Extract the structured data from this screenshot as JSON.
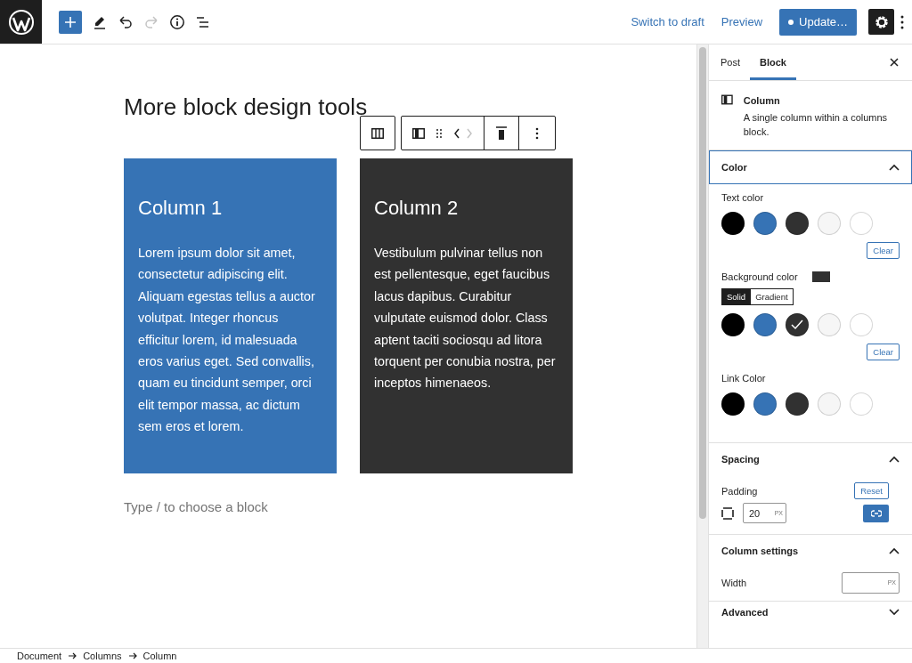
{
  "topbar": {
    "tools": [
      {
        "kind": "inserter",
        "disabled": false
      },
      {
        "kind": "edit",
        "disabled": false
      },
      {
        "kind": "undo",
        "disabled": false
      },
      {
        "kind": "redo",
        "disabled": true
      },
      {
        "kind": "details",
        "disabled": false
      },
      {
        "kind": "outline",
        "disabled": false
      }
    ],
    "links": [
      "Switch to draft",
      "Preview"
    ],
    "update_button": "Update…",
    "settings_active": true
  },
  "editor": {
    "title": "More block design tools",
    "block_toolbar": {
      "movers": [
        {
          "kind": "left",
          "disabled": false
        },
        {
          "kind": "right",
          "disabled": true
        }
      ]
    },
    "columns": [
      {
        "heading": "Column 1",
        "text": "Lorem ipsum dolor sit amet, consectetur adipiscing elit. Aliquam egestas tellus a auctor volutpat. Integer rhoncus efficitur lorem, id malesuada eros varius eget. Sed convallis, quam eu tincidunt semper, orci elit tempor massa, ac dictum sem eros et lorem.",
        "color": "#3673b5"
      },
      {
        "heading": "Column 2",
        "text": "Vestibulum pulvinar tellus non est pellentesque, eget faucibus lacus dapibus. Curabitur vulputate euismod dolor. Class aptent taciti sociosqu ad litora torquent per conubia nostra, per inceptos himenaeos.",
        "color": "#313131"
      }
    ],
    "placeholder": "Type / to choose a block"
  },
  "sidebar": {
    "tabs": [
      {
        "label": "Post",
        "selected": false
      },
      {
        "label": "Block",
        "selected": true
      }
    ],
    "block": {
      "name": "Column",
      "description": "A single column within a columns block."
    },
    "color_panel": {
      "title": "Color",
      "expanded": true,
      "groups": [
        {
          "label": "Text color",
          "swatches": [
            {
              "color": "#000000",
              "selected": false
            },
            {
              "color": "#3673b5",
              "selected": false
            },
            {
              "color": "#313131",
              "selected": false
            },
            {
              "color": "#f6f6f6",
              "selected": false
            },
            {
              "color": "#ffffff",
              "selected": false
            }
          ],
          "clear": "Clear"
        },
        {
          "label": "Background color",
          "indicator": {
            "color": "#313131"
          },
          "modes": [
            {
              "label": "Solid",
              "selected": true
            },
            {
              "label": "Gradient",
              "selected": false
            }
          ],
          "swatches": [
            {
              "color": "#000000",
              "selected": false
            },
            {
              "color": "#3673b5",
              "selected": false
            },
            {
              "color": "#313131",
              "selected": true
            },
            {
              "color": "#f6f6f6",
              "selected": false
            },
            {
              "color": "#ffffff",
              "selected": false
            }
          ],
          "clear": "Clear"
        },
        {
          "label": "Link Color",
          "swatches": [
            {
              "color": "#000000",
              "selected": false
            },
            {
              "color": "#3673b5",
              "selected": false
            },
            {
              "color": "#313131",
              "selected": false
            },
            {
              "color": "#f6f6f6",
              "selected": false
            },
            {
              "color": "#ffffff",
              "selected": false
            }
          ]
        }
      ]
    },
    "spacing_panel": {
      "title": "Spacing",
      "expanded": true,
      "label": "Padding",
      "reset": "Reset",
      "value": "20",
      "unit": "PX",
      "linked": true
    },
    "column_panel": {
      "title": "Column settings",
      "expanded": true,
      "label": "Width",
      "unit": "PX"
    },
    "advanced_panel": {
      "title": "Advanced",
      "expanded": false
    }
  },
  "breadcrumb": [
    "Document",
    "Columns",
    "Column"
  ]
}
